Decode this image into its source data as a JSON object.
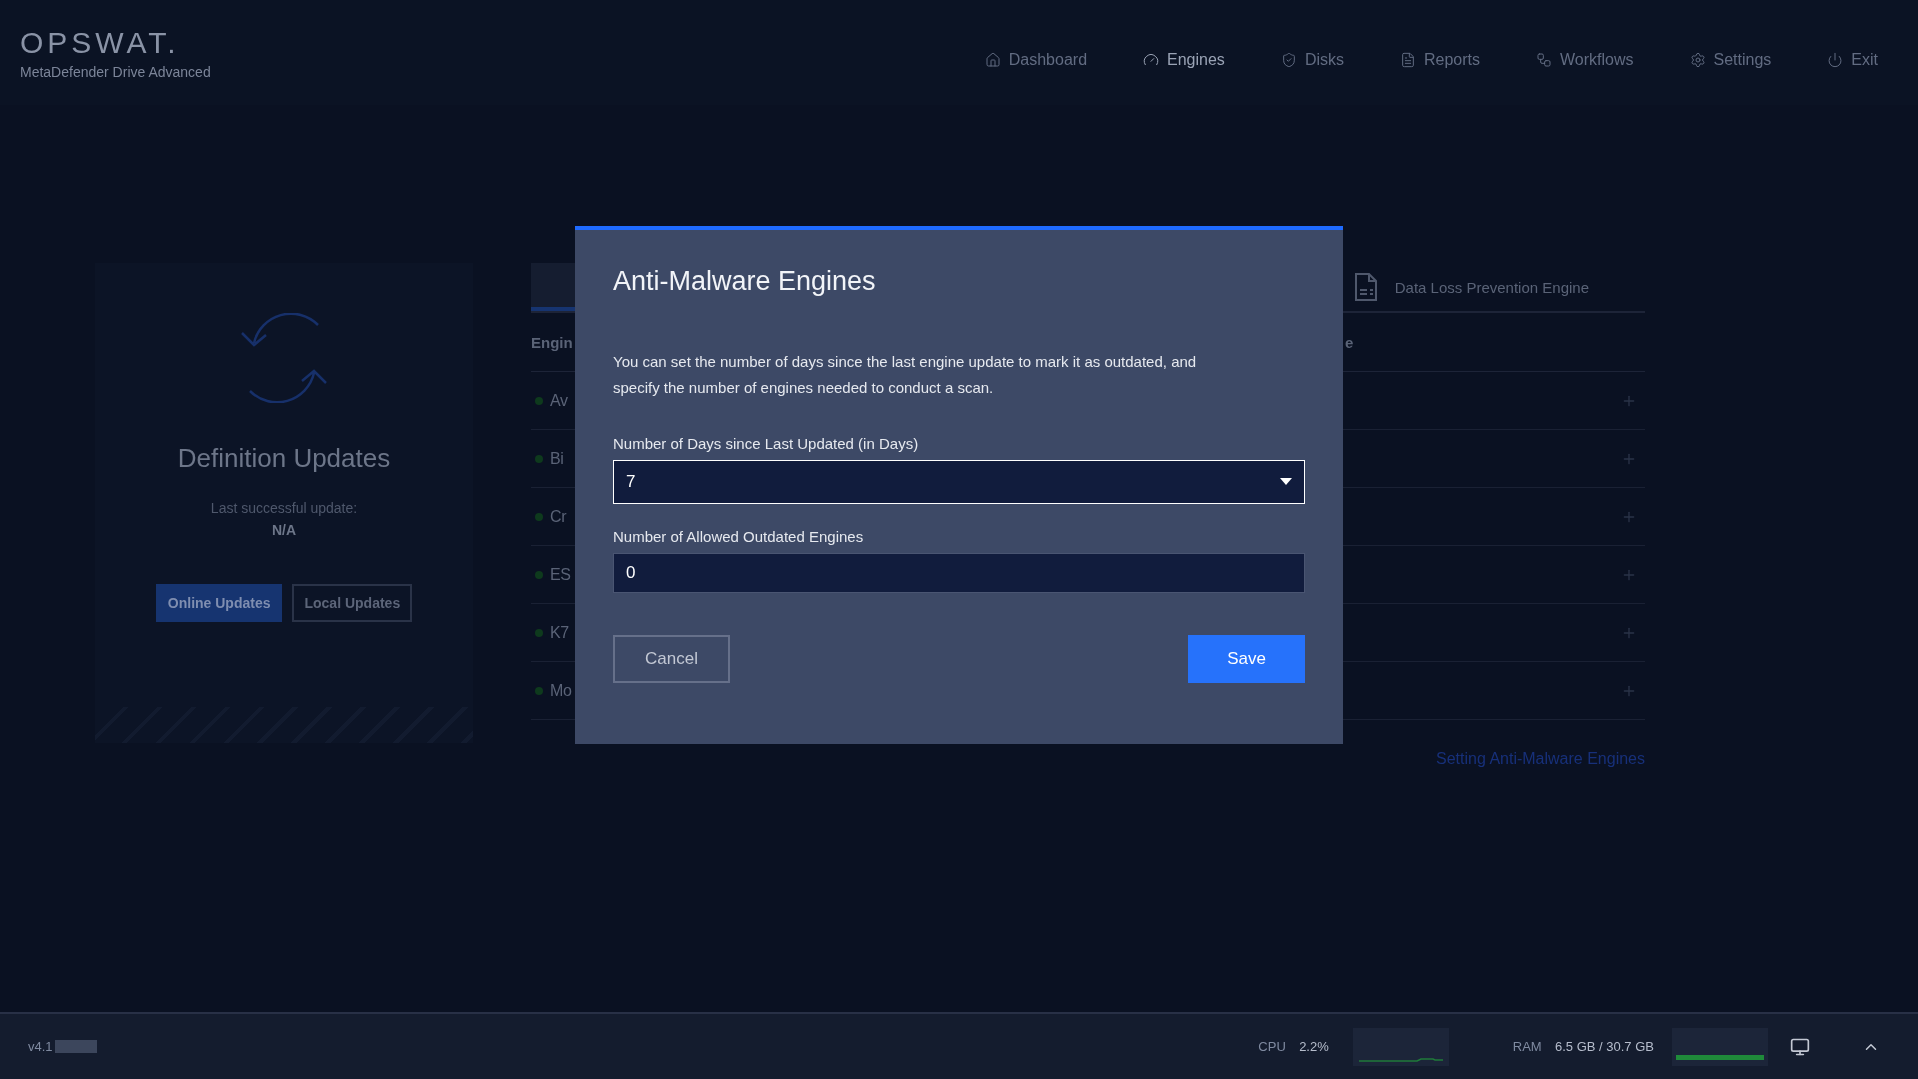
{
  "app": {
    "logo": "OPSWAT.",
    "product": "MetaDefender Drive Advanced"
  },
  "nav": [
    {
      "label": "Dashboard",
      "selected": false
    },
    {
      "label": "Engines",
      "selected": true
    },
    {
      "label": "Disks",
      "selected": false
    },
    {
      "label": "Reports",
      "selected": false
    },
    {
      "label": "Workflows",
      "selected": false
    },
    {
      "label": "Settings",
      "selected": false
    },
    {
      "label": "Exit",
      "selected": false
    }
  ],
  "definition_card": {
    "title": "Definition Updates",
    "caption": "Last successful update:",
    "value": "N/A",
    "buttons": [
      {
        "label": "Online Updates",
        "selected": true
      },
      {
        "label": "Local Updates",
        "selected": false
      }
    ]
  },
  "engines_panel": {
    "tabs": [
      {
        "label": "Data Loss Prevention Engine",
        "selected": false
      }
    ],
    "columns": [
      "Engin",
      "e"
    ],
    "rows": [
      {
        "name": "Av"
      },
      {
        "name": "Bi"
      },
      {
        "name": "Cr"
      },
      {
        "name": "ES"
      },
      {
        "name": "K7"
      },
      {
        "name": "Mo"
      }
    ],
    "link": "Setting Anti-Malware Engines"
  },
  "dialog": {
    "title": "Anti-Malware Engines",
    "text": "You can set the number of days since the last engine update to mark it as outdated, and specify the number of engines needed to conduct a scan.",
    "fields": [
      {
        "kind": "select",
        "label": "Number of Days since Last Updated (in Days)",
        "value": "7",
        "focused": true
      },
      {
        "kind": "input",
        "label": "Number of Allowed Outdated Engines",
        "value": "0",
        "focused": false
      }
    ],
    "cancel": "Cancel",
    "save": "Save"
  },
  "status_bar": {
    "version": "v4.1",
    "cpu_label": "CPU",
    "cpu_value": "2.2%",
    "ram_label": "RAM",
    "ram_value": "6.5 GB / 30.7 GB"
  }
}
